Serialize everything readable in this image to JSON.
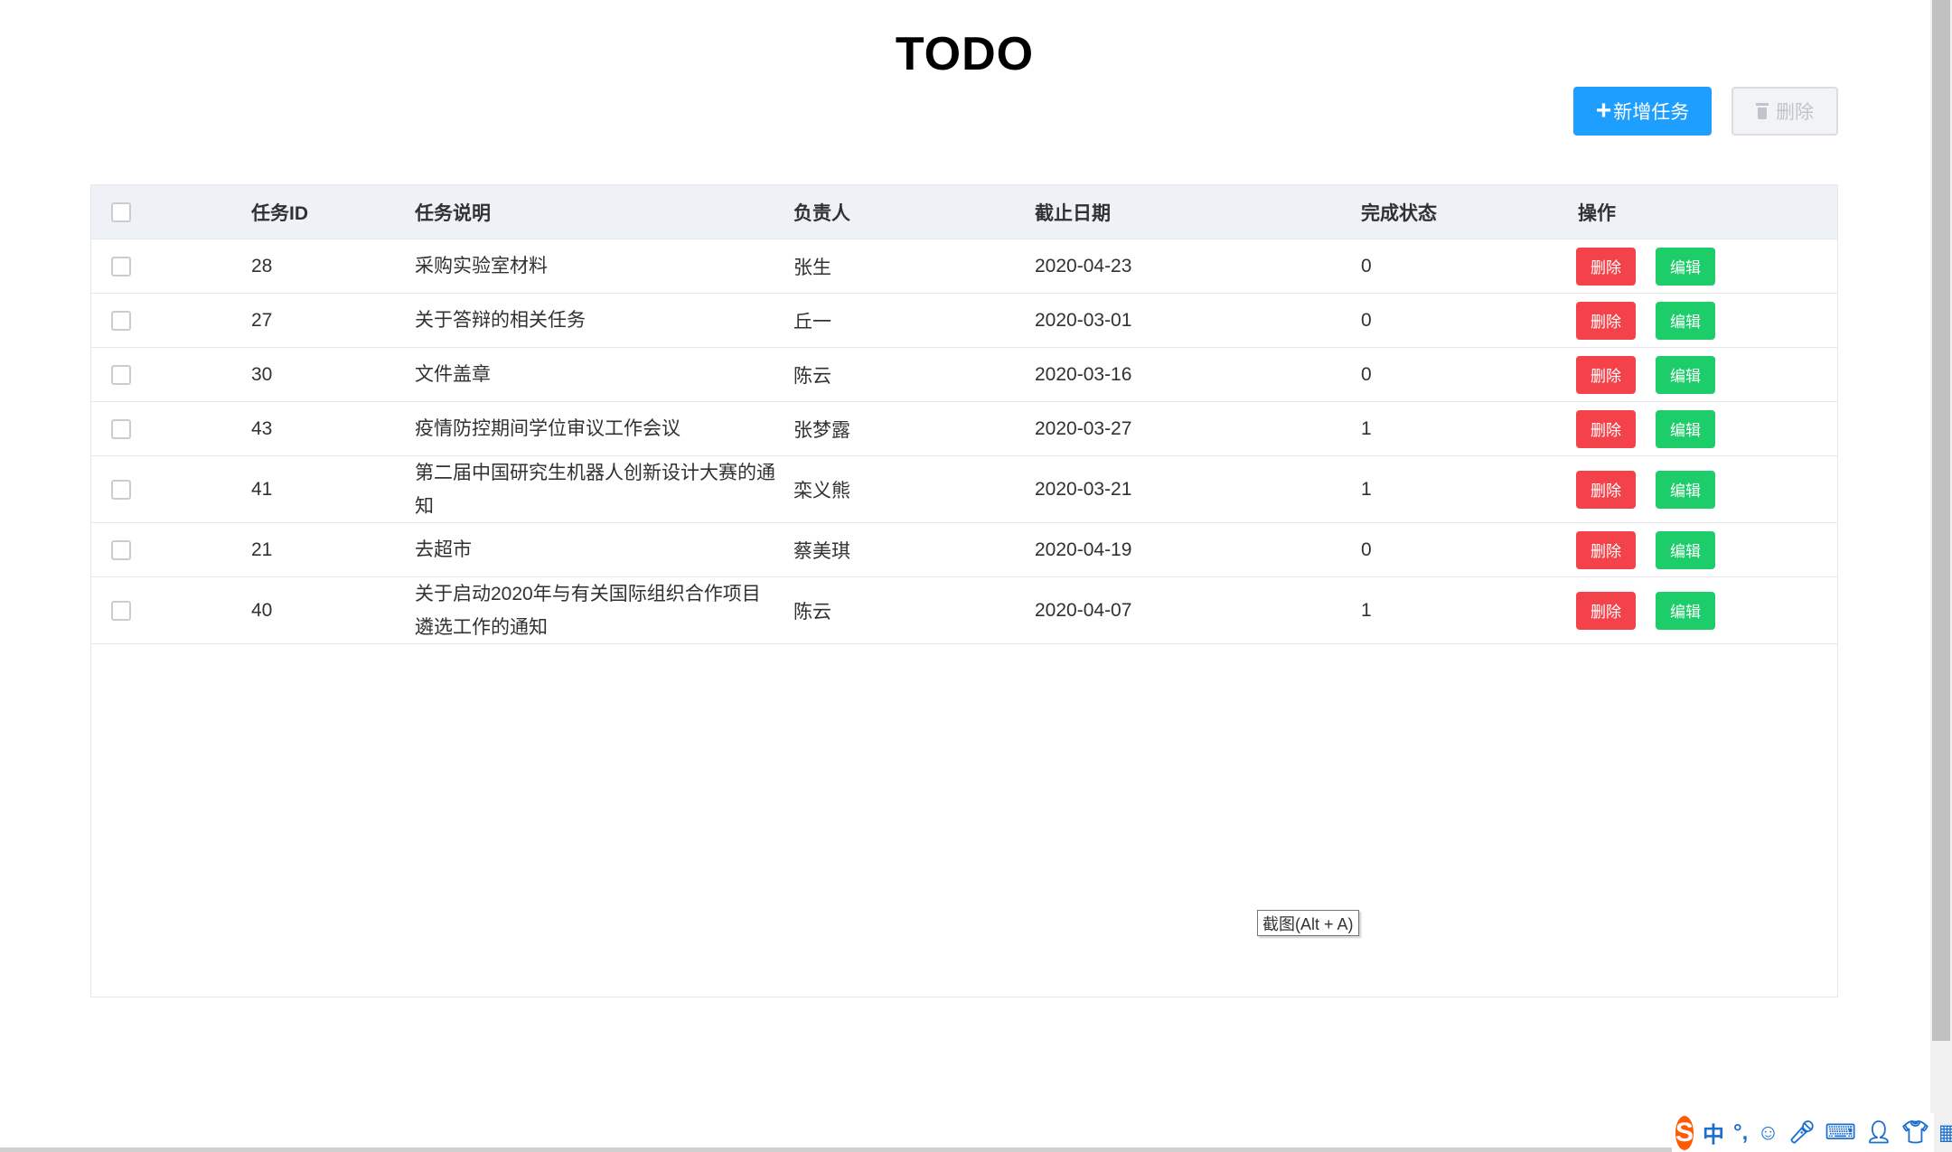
{
  "page": {
    "title": "TODO"
  },
  "toolbar": {
    "add_label": "新增任务",
    "add_plus": "+",
    "delete_label": "删除"
  },
  "table": {
    "columns": [
      "任务ID",
      "任务说明",
      "负责人",
      "截止日期",
      "完成状态",
      "操作"
    ],
    "rows": [
      {
        "id": "28",
        "desc": "采购实验室材料",
        "owner": "张生",
        "date": "2020-04-23",
        "status": "0"
      },
      {
        "id": "27",
        "desc": "关于答辩的相关任务",
        "owner": "丘一",
        "date": "2020-03-01",
        "status": "0"
      },
      {
        "id": "30",
        "desc": "文件盖章",
        "owner": "陈云",
        "date": "2020-03-16",
        "status": "0"
      },
      {
        "id": "43",
        "desc": "疫情防控期间学位审议工作会议",
        "owner": "张梦露",
        "date": "2020-03-27",
        "status": "1"
      },
      {
        "id": "41",
        "desc": "第二届中国研究生机器人创新设计大赛的通知",
        "owner": "栾义熊",
        "date": "2020-03-21",
        "status": "1"
      },
      {
        "id": "21",
        "desc": "去超市",
        "owner": "蔡美琪",
        "date": "2020-04-19",
        "status": "0"
      },
      {
        "id": "40",
        "desc": "关于启动2020年与有关国际组织合作项目遴选工作的通知",
        "owner": "陈云",
        "date": "2020-04-07",
        "status": "1"
      }
    ],
    "row_actions": {
      "delete_label": "删除",
      "edit_label": "编辑"
    }
  },
  "tooltip": {
    "text": "截图(Alt + A)"
  },
  "ime": {
    "logo": "S",
    "mode": "中",
    "punct": "°,"
  },
  "colors": {
    "primary": "#1e9fff",
    "danger": "#f3424a",
    "success": "#1ccd6a",
    "header_bg": "#eef1f6"
  }
}
